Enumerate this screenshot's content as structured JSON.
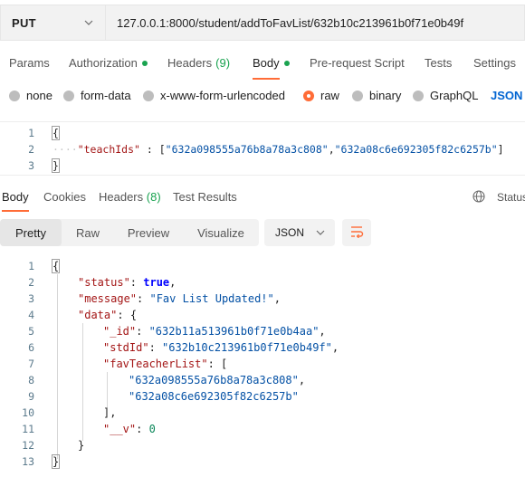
{
  "request": {
    "method": "PUT",
    "url": "127.0.0.1:8000/student/addToFavList/632b10c213961b0f71e0b49f"
  },
  "request_tabs": {
    "params": "Params",
    "authorization": "Authorization",
    "headers": "Headers",
    "headers_count": "(9)",
    "body": "Body",
    "pre_request_script": "Pre-request Script",
    "tests": "Tests",
    "settings": "Settings"
  },
  "body_types": {
    "none": "none",
    "form_data": "form-data",
    "urlencoded": "x-www-form-urlencoded",
    "raw": "raw",
    "binary": "binary",
    "graphql": "GraphQL",
    "language": "JSON"
  },
  "request_body": {
    "line_numbers": [
      "1",
      "2",
      "3"
    ],
    "open_brace": "{",
    "close_brace": "}",
    "indent_dots": "····",
    "key": "\"teachIds\"",
    "colon": " : ",
    "array_open": "[",
    "value1": "\"632a098555a76b8a78a3c808\"",
    "comma": ",",
    "value2": "\"632a08c6e692305f82c6257b\"",
    "array_close": "]"
  },
  "response_tabs": {
    "body": "Body",
    "cookies": "Cookies",
    "headers": "Headers",
    "headers_count": "(8)",
    "test_results": "Test Results",
    "status": "Status"
  },
  "view_modes": {
    "pretty": "Pretty",
    "raw": "Raw",
    "preview": "Preview",
    "visualize": "Visualize",
    "format": "JSON"
  },
  "response_body": {
    "line_numbers": [
      "1",
      "2",
      "3",
      "4",
      "5",
      "6",
      "7",
      "8",
      "9",
      "10",
      "11",
      "12",
      "13"
    ],
    "l1": "{",
    "l2_key": "\"status\"",
    "l2_val": "true",
    "l3_key": "\"message\"",
    "l3_val": "\"Fav List Updated!\"",
    "l4_key": "\"data\"",
    "l4_val": "{",
    "l5_key": "\"_id\"",
    "l5_val": "\"632b11a513961b0f71e0b4aa\"",
    "l6_key": "\"stdId\"",
    "l6_val": "\"632b10c213961b0f71e0b49f\"",
    "l7_key": "\"favTeacherList\"",
    "l7_val": "[",
    "l8_val": "\"632a098555a76b8a78a3c808\"",
    "l9_val": "\"632a08c6e692305f82c6257b\"",
    "l10": "],",
    "l11_key": "\"__v\"",
    "l11_val": "0",
    "l12": "}",
    "l13": "}",
    "colon": ": ",
    "comma": ","
  },
  "colors": {
    "accent": "#ff6c37",
    "success_dot": "#1aa350",
    "json_link": "#0265d2"
  }
}
